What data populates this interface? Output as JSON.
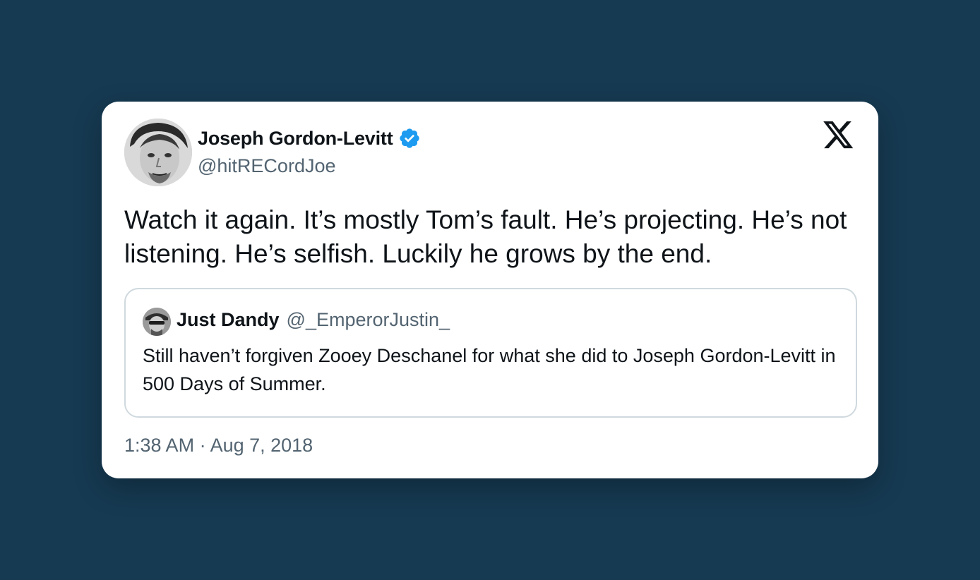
{
  "tweet": {
    "author": {
      "name": "Joseph Gordon-Levitt",
      "handle": "@hitRECordJoe",
      "verified": true,
      "avatar_icon": "avatar-photo-icon"
    },
    "platform_icon": "x-logo-icon",
    "text": "Watch it again. It’s mostly Tom’s fault. He’s projecting. He’s not listening. He’s selfish. Luckily he grows by the end.",
    "timestamp": "1:38 AM · Aug 7, 2018",
    "quoted": {
      "name": "Just Dandy",
      "handle": "@_EmperorJustin_",
      "text": "Still haven’t forgiven Zooey Deschanel for what she did to Joseph Gordon-Levitt in 500 Days of Summer.",
      "avatar_icon": "avatar-photo-icon"
    }
  },
  "colors": {
    "background": "#163a52",
    "card": "#ffffff",
    "primary_text": "#0f1419",
    "secondary_text": "#536471",
    "verified_blue": "#1d9bf0",
    "quote_border": "#cfd9de"
  }
}
